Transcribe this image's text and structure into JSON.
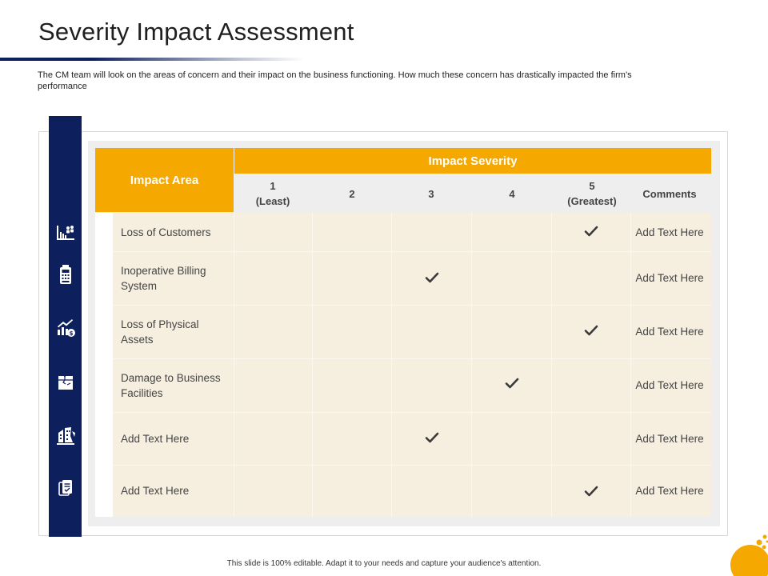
{
  "slide": {
    "title": "Severity Impact Assessment",
    "subtitle": "The CM team will look on the areas of concern and their impact on the business functioning. How much these concern has drastically impacted the firm’s performance",
    "footer": "This slide is 100% editable.  Adapt it to your needs and capture your audience's attention."
  },
  "table": {
    "area_header": "Impact Area",
    "severity_header": "Impact Severity",
    "columns": [
      "1\n(Least)",
      "2",
      "3",
      "4",
      "5\n(Greatest)",
      "Comments"
    ],
    "rows": [
      {
        "area": "Loss of Customers",
        "severity": 5,
        "comment": "Add Text Here",
        "icon": "customers-chart-icon"
      },
      {
        "area": "Inoperative Billing System",
        "severity": 3,
        "comment": "Add Text Here",
        "icon": "billing-machine-icon"
      },
      {
        "area": "Loss of Physical Assets",
        "severity": 5,
        "comment": "Add Text Here",
        "icon": "assets-growth-chart-icon"
      },
      {
        "area": "Damage to Business Facilities",
        "severity": 4,
        "comment": "Add Text Here",
        "icon": "damaged-box-icon"
      },
      {
        "area": "Add Text Here",
        "severity": 3,
        "comment": "Add Text Here",
        "icon": "broken-building-icon"
      },
      {
        "area": "Add Text Here",
        "severity": 5,
        "comment": "Add Text Here",
        "icon": "documents-check-icon"
      }
    ]
  },
  "colors": {
    "navy": "#0d1f5c",
    "accent": "#f5a800",
    "row_fill": "#f6efe0",
    "panel": "#eeeeee"
  }
}
